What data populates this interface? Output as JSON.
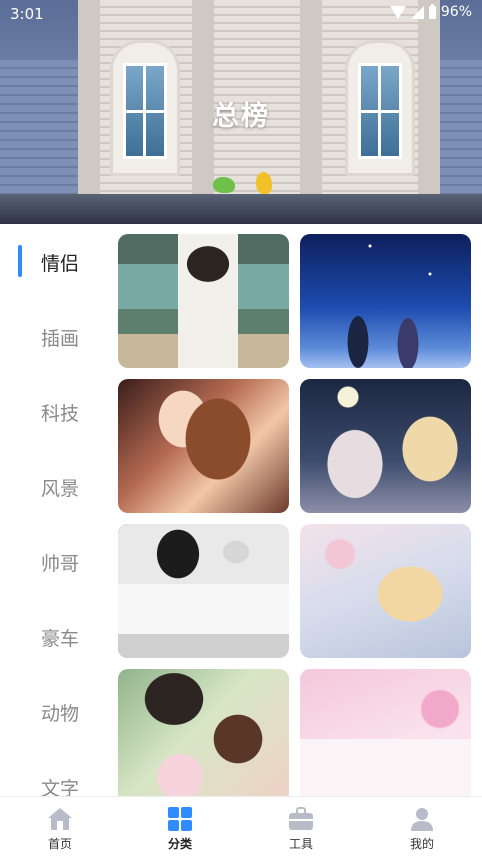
{
  "status_bar": {
    "time": "3:01",
    "battery": "96%"
  },
  "header": {
    "title": "总榜"
  },
  "categories": [
    {
      "label": "情侣",
      "active": true
    },
    {
      "label": "插画",
      "active": false
    },
    {
      "label": "科技",
      "active": false
    },
    {
      "label": "风景",
      "active": false
    },
    {
      "label": "帅哥",
      "active": false
    },
    {
      "label": "豪车",
      "active": false
    },
    {
      "label": "动物",
      "active": false
    },
    {
      "label": "文字",
      "active": false
    }
  ],
  "wallpapers": [
    {
      "name": "couple-train"
    },
    {
      "name": "couple-night-sky"
    },
    {
      "name": "couple-embrace"
    },
    {
      "name": "couple-moon"
    },
    {
      "name": "couple-sketch"
    },
    {
      "name": "couple-flowers"
    },
    {
      "name": "couple-cottoncandy"
    },
    {
      "name": "couple-letter"
    }
  ],
  "bottom_nav": [
    {
      "label": "首页",
      "icon": "home-icon",
      "active": false
    },
    {
      "label": "分类",
      "icon": "grid-icon",
      "active": true
    },
    {
      "label": "工具",
      "icon": "toolbox-icon",
      "active": false
    },
    {
      "label": "我的",
      "icon": "profile-icon",
      "active": false
    }
  ],
  "colors": {
    "accent": "#2f8cff",
    "nav_inactive": "#b7bcc8"
  }
}
